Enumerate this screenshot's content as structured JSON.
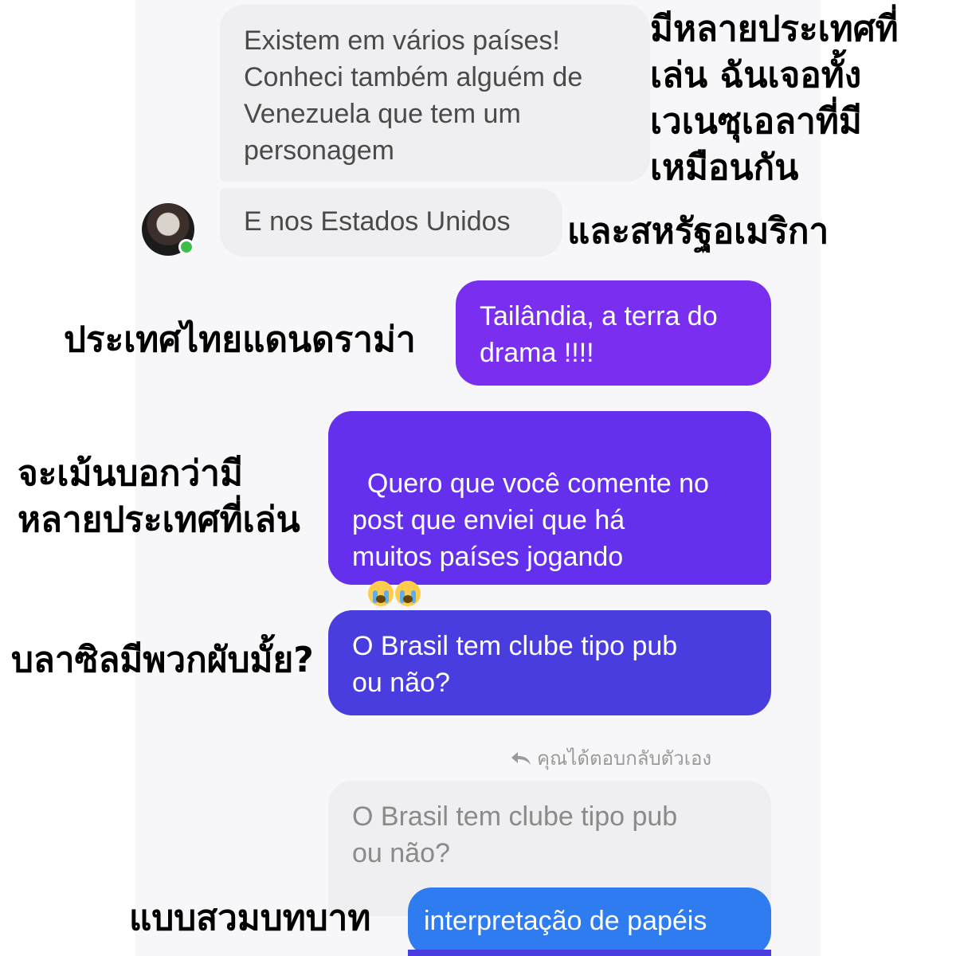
{
  "messages": {
    "in_1": "Existem em vários países!\nConheci também alguém de\nVenezuela que tem um\npersonagem",
    "in_2": "E nos Estados Unidos",
    "out_1": "Tailândia, a terra do\ndrama !!!!",
    "out_2": "Quero que você comente no\npost que enviei que há\nmuitos países jogando",
    "out_3": "O Brasil tem clube tipo pub\nou não?",
    "reply_hint": "คุณได้ตอบกลับตัวเอง",
    "quoted": "O Brasil tem clube tipo pub\nou não?",
    "out_4": "interpretação de papéis"
  },
  "annotations": {
    "a1": "มีหลายประเทศที่\nเล่น ฉันเจอทั้ง\nเวเนซุเอลาที่มี\nเหมือนกัน",
    "a2": "และสหรัฐอเมริกา",
    "a3": "ประเทศไทยแดนดราม่า",
    "a4": "จะเม้นบอกว่ามี\nหลายประเทศที่เล่น",
    "a5": "บลาซิลมีพวกผับมั้ย?",
    "a6": "แบบสวมบทบาท"
  },
  "colors": {
    "incoming": "#efeff1",
    "outgoing_top": "#7a2ff0",
    "outgoing_bottom": "#3d4df0",
    "online": "#3bbf4a"
  },
  "icons": {
    "emoji": "loudly-crying-face",
    "reply": "reply-arrow-icon"
  }
}
